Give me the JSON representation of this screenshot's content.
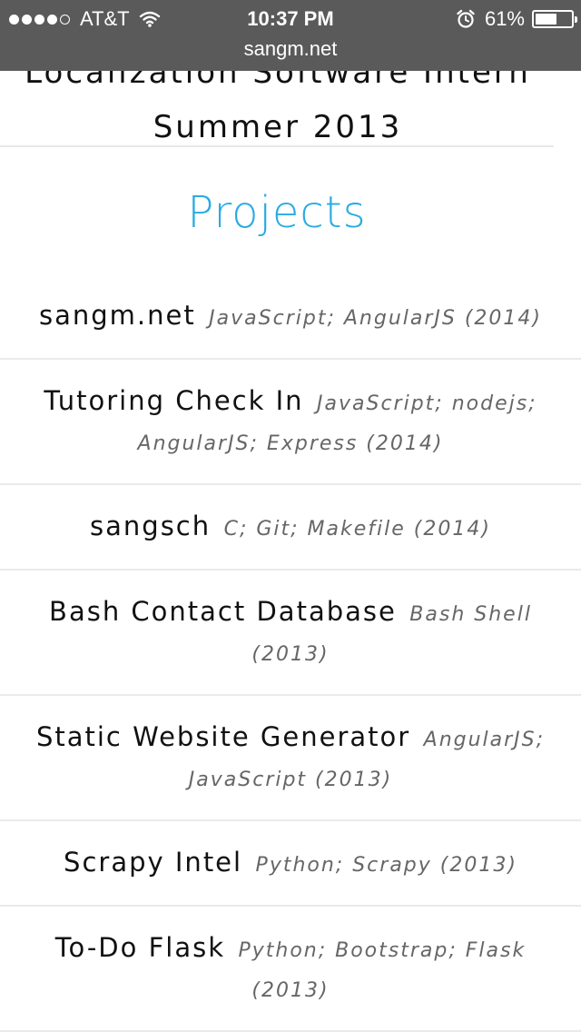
{
  "status_bar": {
    "carrier": "AT&T",
    "signal_bars": 4,
    "signal_max": 5,
    "time": "10:37 PM",
    "battery_percent": "61%",
    "battery_level": 0.61,
    "icons": [
      "wifi-icon",
      "alarm-icon",
      "battery-icon"
    ]
  },
  "url_bar": {
    "url": "sangm.net"
  },
  "header": {
    "title_line1": "Localization Software Intern",
    "title_line2": "Summer 2013"
  },
  "projects_section": {
    "heading": "Projects",
    "heading_color": "#29abe2",
    "items": [
      {
        "name": "sangm.net",
        "tech": "JavaScript; AngularJS (2014)"
      },
      {
        "name": "Tutoring Check In",
        "tech": "JavaScript; nodejs; AngularJS; Express (2014)"
      },
      {
        "name": "sangsch",
        "tech": "C; Git; Makefile (2014)"
      },
      {
        "name": "Bash Contact Database",
        "tech": "Bash Shell (2013)"
      },
      {
        "name": "Static Website Generator",
        "tech": "AngularJS; JavaScript (2013)"
      },
      {
        "name": "Scrapy Intel",
        "tech": "Python; Scrapy (2013)"
      },
      {
        "name": "To-Do Flask",
        "tech": "Python; Bootstrap; Flask (2013)"
      }
    ]
  }
}
